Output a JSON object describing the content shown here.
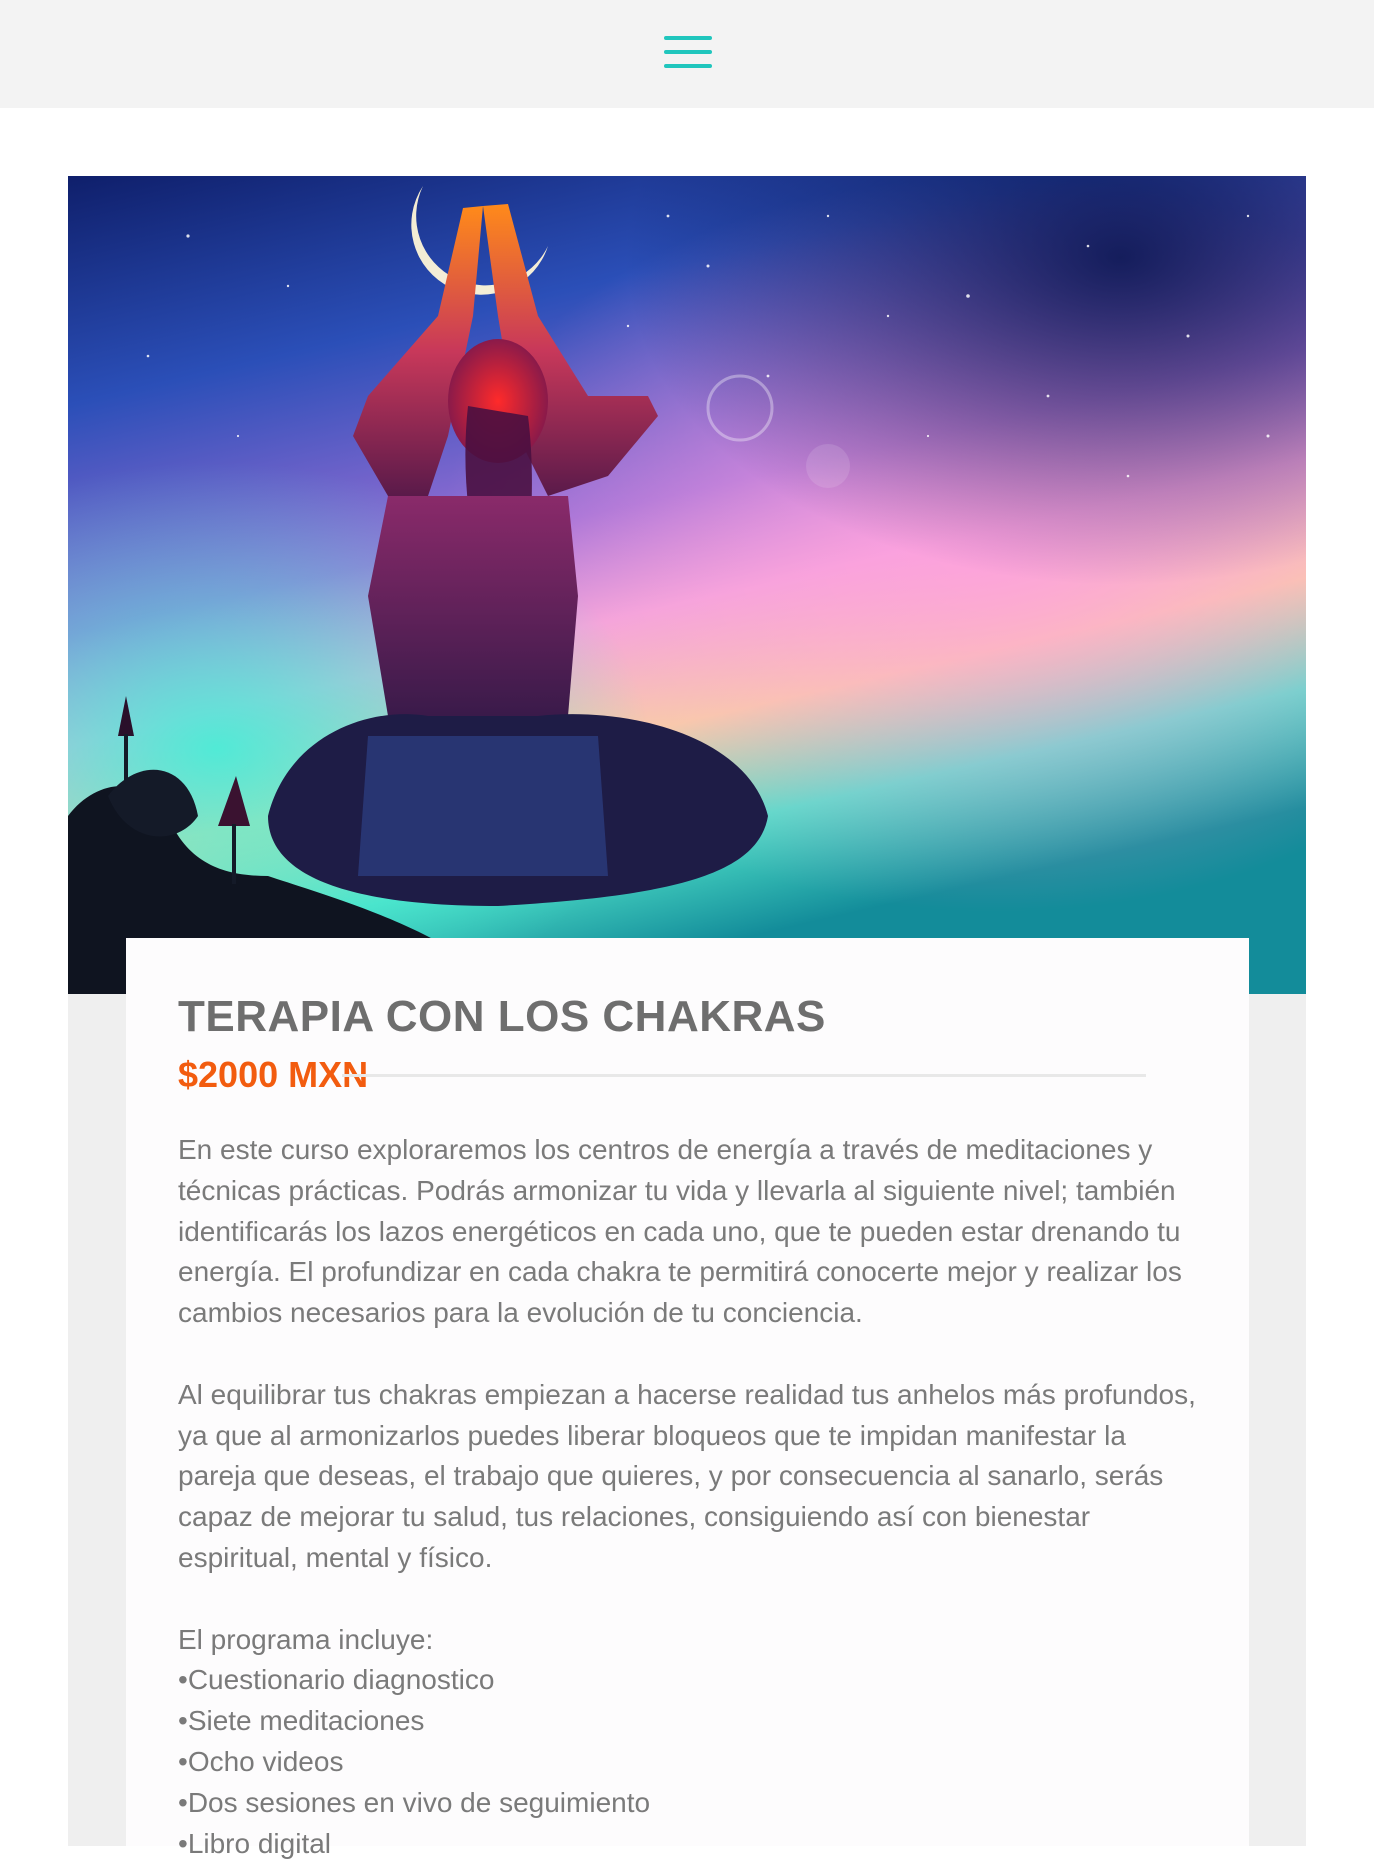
{
  "header": {
    "menu_icon": "hamburger-menu-icon",
    "accent_color": "#20c6bd"
  },
  "hero": {
    "image": "yoga-silhouette-cosmic-sky"
  },
  "course": {
    "title": "TERAPIA CON LOS CHAKRAS",
    "price": "$2000 MXN",
    "price_color": "#f25c0f",
    "paragraph1": "En este curso exploraremos los centros de energía a través de meditaciones y técnicas prácticas. Podrás armonizar tu vida y llevarla al siguiente nivel; también identificarás los lazos energéticos en cada uno, que te pueden estar drenando tu energía. El profundizar en cada chakra te permitirá conocerte mejor y realizar los cambios necesarios para la evolución de tu conciencia.",
    "paragraph2": "Al equilibrar tus chakras empiezan a hacerse realidad tus anhelos más profundos, ya que al armonizarlos puedes liberar bloqueos que te impidan manifestar la pareja que deseas, el trabajo que quieres, y por consecuencia al sanarlo, serás capaz de mejorar tu salud, tus relaciones, consiguiendo así con bienestar espiritual, mental y físico.",
    "program_heading": "El programa incluye:",
    "program_items": [
      "Cuestionario diagnostico",
      "Siete meditaciones",
      "Ocho videos",
      "Dos sesiones en vivo de seguimiento",
      "Libro digital"
    ]
  }
}
